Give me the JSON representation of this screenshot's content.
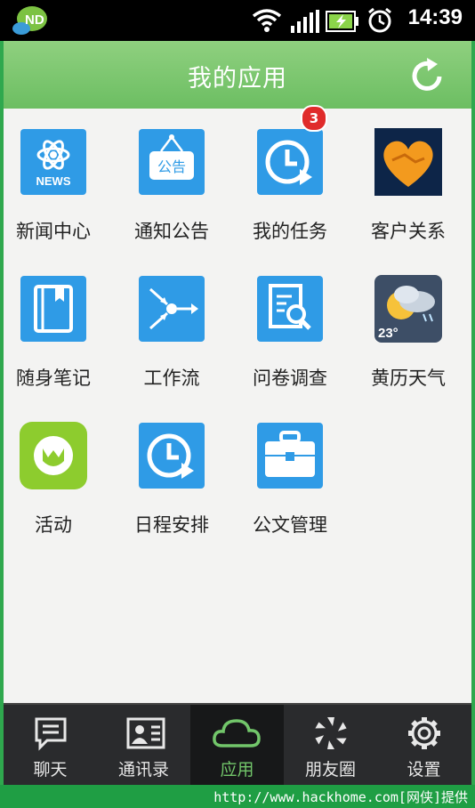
{
  "status_bar": {
    "time": "14:39",
    "logo_text": "ND",
    "icons": [
      "nd-app-icon",
      "wifi-icon",
      "signal-icon",
      "battery-charging-icon",
      "alarm-icon"
    ]
  },
  "header": {
    "title": "我的应用",
    "refresh_icon": "refresh-icon",
    "color": "#6cbe62"
  },
  "apps": [
    {
      "label": "新闻中心",
      "icon": "news-icon",
      "icon_text": "NEWS"
    },
    {
      "label": "通知公告",
      "icon": "notice-board-icon",
      "icon_text": "公告"
    },
    {
      "label": "我的任务",
      "icon": "task-clock-icon",
      "badge": "3"
    },
    {
      "label": "客户关系",
      "icon": "handshake-heart-icon"
    },
    {
      "label": "随身笔记",
      "icon": "notebook-icon"
    },
    {
      "label": "工作流",
      "icon": "workflow-icon"
    },
    {
      "label": "问卷调查",
      "icon": "survey-search-icon"
    },
    {
      "label": "黄历天气",
      "icon": "weather-icon",
      "icon_text": "23°"
    },
    {
      "label": "活动",
      "icon": "activity-icon"
    },
    {
      "label": "日程安排",
      "icon": "schedule-clock-icon"
    },
    {
      "label": "公文管理",
      "icon": "briefcase-icon"
    }
  ],
  "bottom_nav": [
    {
      "label": "聊天",
      "icon": "chat-icon",
      "active": false
    },
    {
      "label": "通讯录",
      "icon": "contacts-icon",
      "active": false
    },
    {
      "label": "应用",
      "icon": "cloud-icon",
      "active": true
    },
    {
      "label": "朋友圈",
      "icon": "moments-icon",
      "active": false
    },
    {
      "label": "设置",
      "icon": "settings-gear-icon",
      "active": false
    }
  ],
  "watermark": "http://www.hackhome.com[网侠]提供"
}
